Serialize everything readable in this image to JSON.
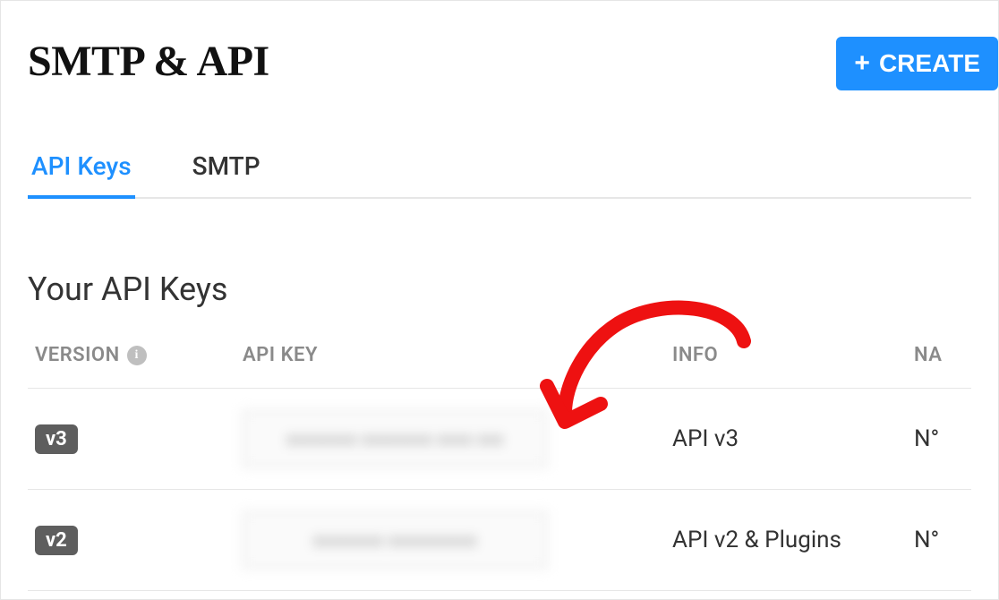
{
  "header": {
    "title": "SMTP & API",
    "create_label": "CREATE"
  },
  "tabs": [
    {
      "label": "API Keys",
      "active": true
    },
    {
      "label": "SMTP",
      "active": false
    }
  ],
  "section": {
    "title": "Your API Keys"
  },
  "table": {
    "columns": {
      "version": "VERSION",
      "apikey": "API KEY",
      "info": "INFO",
      "name": "NA"
    },
    "rows": [
      {
        "version": "v3",
        "apikey_masked": "xxxxxxxx xxxxxxxx xxxx xxx",
        "info": "API v3",
        "name": "N°"
      },
      {
        "version": "v2",
        "apikey_masked": "xxxxxxxx xxxxxxxxxx",
        "info": "API v2 & Plugins",
        "name": "N°"
      }
    ]
  },
  "icons": {
    "info_glyph": "i",
    "plus_glyph": "+"
  }
}
